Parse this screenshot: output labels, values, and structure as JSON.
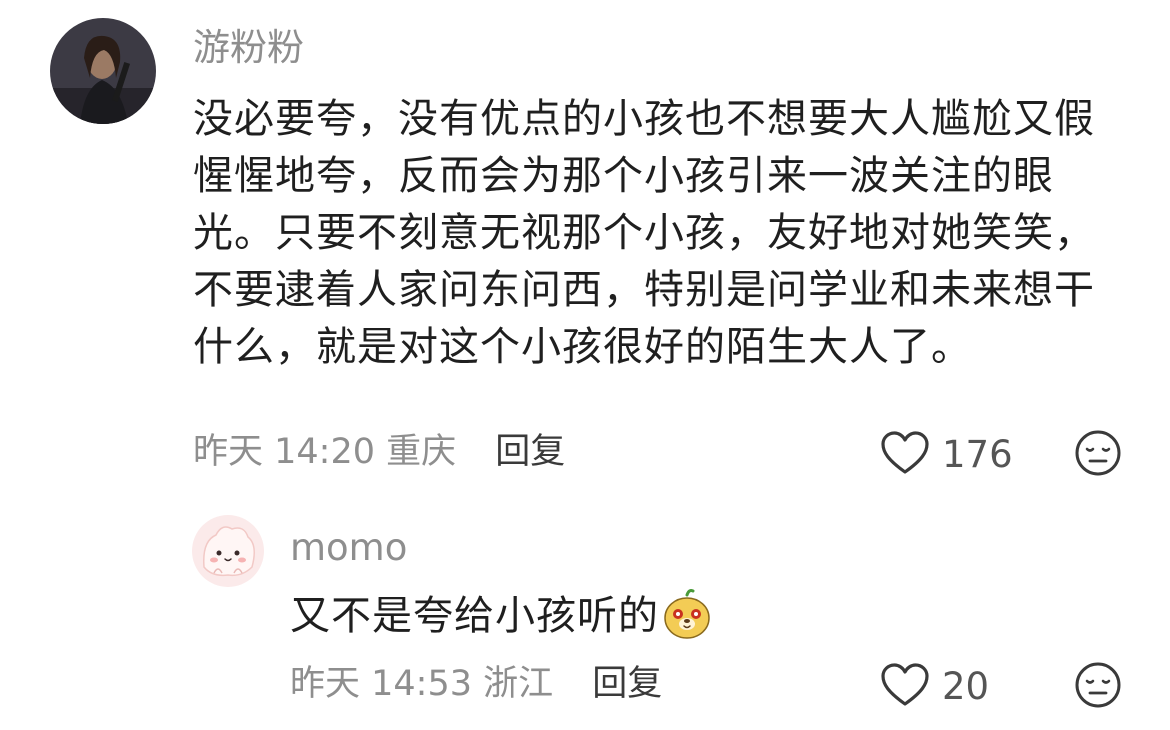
{
  "comments": [
    {
      "username": "游粉粉",
      "text_lines": [
        "没必要夸，没有优点的小孩也不想要大人尴尬又假",
        "惺惺地夸，反而会为那个小孩引来一波关注的眼",
        "光。只要不刻意无视那个小孩，友好地对她笑笑，",
        "不要逮着人家问东问西，特别是问学业和未来想干",
        "什么，就是对这个小孩很好的陌生大人了。"
      ],
      "time": "昨天 14:20",
      "location": "重庆",
      "reply_label": "回复",
      "likes": "176",
      "like_icon": "heart-outline-icon",
      "reaction_icon": "meh-face-icon"
    },
    {
      "username": "momo",
      "text": "又不是夸给小孩听的",
      "inline_emoji": "cute-dog-emoji",
      "time": "昨天 14:53",
      "location": "浙江",
      "reply_label": "回复",
      "likes": "20",
      "like_icon": "heart-outline-icon",
      "reaction_icon": "meh-face-icon"
    }
  ]
}
